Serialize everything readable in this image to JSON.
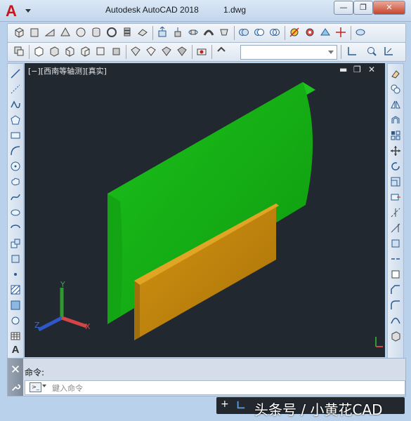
{
  "titlebar": {
    "app_title": "Autodesk AutoCAD 2018",
    "file_name": "1.dwg",
    "minimize": "—",
    "restore": "❐",
    "close": "✕"
  },
  "toolbar1": {
    "icons": [
      "box-icon",
      "cylinder-icon",
      "wedge-icon",
      "cone-icon",
      "sphere-icon",
      "cylinder-solid-icon",
      "torus-icon",
      "pyramid-icon",
      "planar-surface-icon",
      "extrude-icon",
      "presspull-icon",
      "revolve-icon",
      "sweep-icon",
      "loft-icon",
      "union-icon",
      "subtract-icon",
      "intersect-icon",
      "slice-icon",
      "interfere-icon",
      "section-icon",
      "3dmove-icon",
      "3drotate-icon"
    ]
  },
  "toolbar2": {
    "icons": [
      "solid-history-icon",
      "box-view-icon",
      "front-view-icon",
      "back-view-icon",
      "left-view-icon",
      "right-view-icon",
      "top-view-icon",
      "sw-iso-icon",
      "se-iso-icon",
      "ne-iso-icon",
      "nw-iso-icon",
      "camera-icon",
      "orbit-icon"
    ],
    "combo_value": "",
    "end_icons": [
      "ucs-icon",
      "zoom-icon",
      "pan-icon"
    ]
  },
  "left_toolbar": {
    "icons": [
      "line-icon",
      "construction-line-icon",
      "polyline-icon",
      "polygon-icon",
      "rectangle-icon",
      "arc-icon",
      "circle-icon",
      "revision-cloud-icon",
      "spline-icon",
      "ellipse-icon",
      "ellipse-arc-icon",
      "insert-block-icon",
      "make-block-icon",
      "point-icon",
      "hatch-icon",
      "gradient-icon",
      "region-icon",
      "table-icon",
      "multiline-text-icon"
    ]
  },
  "right_toolbar": {
    "icons": [
      "erase-icon",
      "copy-icon",
      "mirror-icon",
      "offset-icon",
      "array-icon",
      "move-icon",
      "rotate-icon",
      "scale-icon",
      "stretch-icon",
      "trim-icon",
      "extend-icon",
      "break-at-point-icon",
      "break-icon",
      "join-icon",
      "chamfer-icon",
      "fillet-icon",
      "blend-icon",
      "explode-icon"
    ]
  },
  "viewport": {
    "label": "[−][西南等轴测][真实]",
    "controls": [
      "▬",
      "❐",
      "✕"
    ],
    "ucs": {
      "x": "X",
      "y": "Y",
      "z": "Z"
    },
    "colors": {
      "background": "#212830",
      "green_face": "#17b617",
      "green_top": "#1fc21f",
      "green_side": "#129e12",
      "orange_face": "#c28a12",
      "orange_side": "#a2700a"
    }
  },
  "command": {
    "history": "命令:",
    "placeholder": "鍵入命令"
  },
  "statusbar": {
    "watermark": "头条号 / 小黄花CAD"
  }
}
